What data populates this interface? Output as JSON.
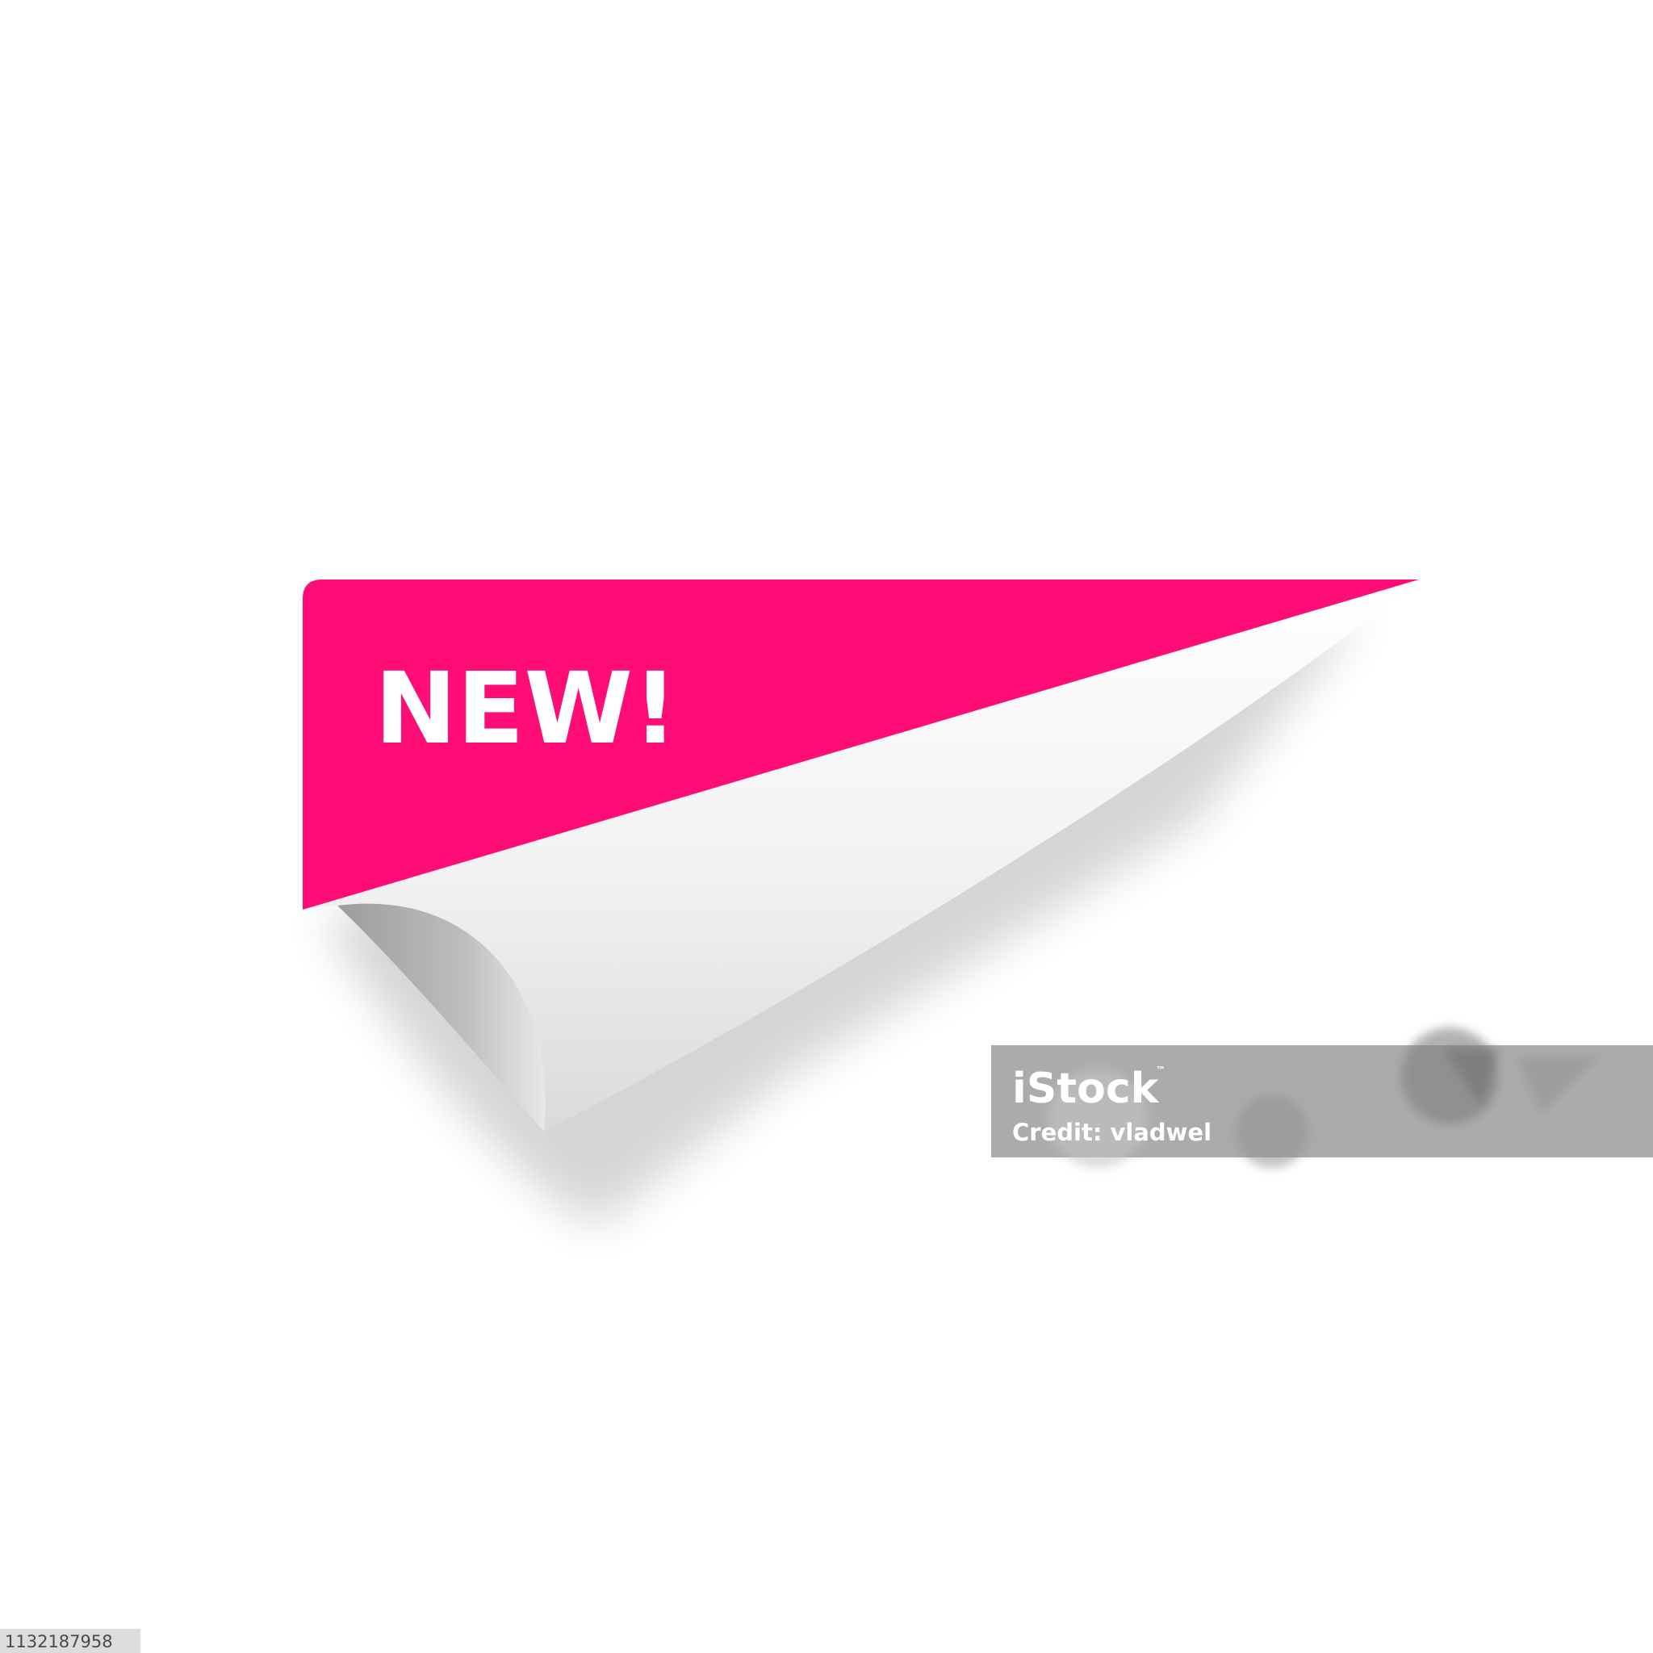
{
  "badge": {
    "label": "NEW!",
    "accent_color": "#FF0D77",
    "label_color": "#FFFFFF",
    "shape": "peeling-corner-sticker"
  },
  "watermark": {
    "brand": "iStock",
    "trademark": "™",
    "credit": "Credit: vladwel",
    "background_color": "#A9ABAD",
    "text_color": "#FFFFFF"
  },
  "image_id": {
    "text": "1132187958",
    "background_color": "#DCDCDC",
    "text_color": "#4A4A4A"
  }
}
